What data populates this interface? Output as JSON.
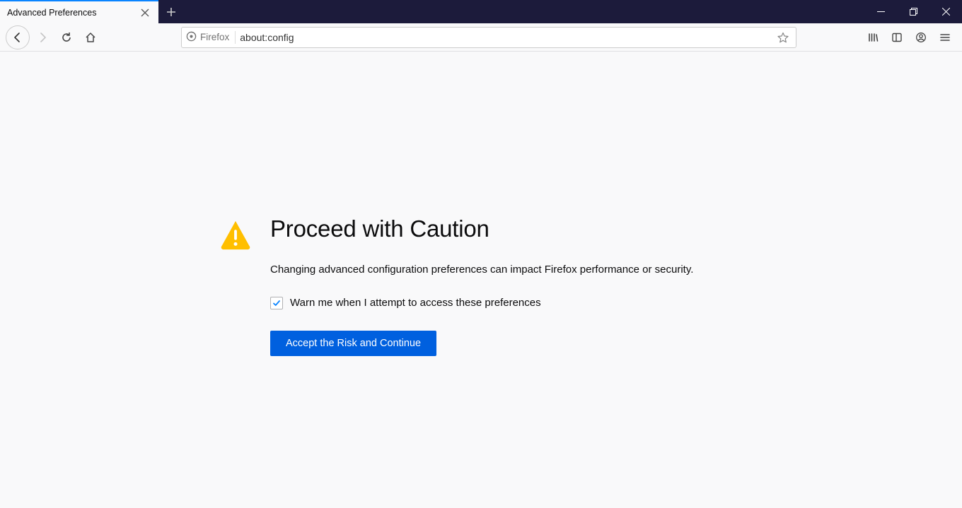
{
  "tab": {
    "title": "Advanced Preferences"
  },
  "urlbar": {
    "identity_label": "Firefox",
    "url": "about:config"
  },
  "warning": {
    "title": "Proceed with Caution",
    "description": "Changing advanced configuration preferences can impact Firefox performance or security.",
    "checkbox_label": "Warn me when I attempt to access these preferences",
    "checkbox_checked": true,
    "button_label": "Accept the Risk and Continue"
  },
  "colors": {
    "accent": "#0a84ff",
    "primary_button": "#0060df",
    "titlebar": "#1c1b3b",
    "warning_icon": "#ffbf00"
  }
}
